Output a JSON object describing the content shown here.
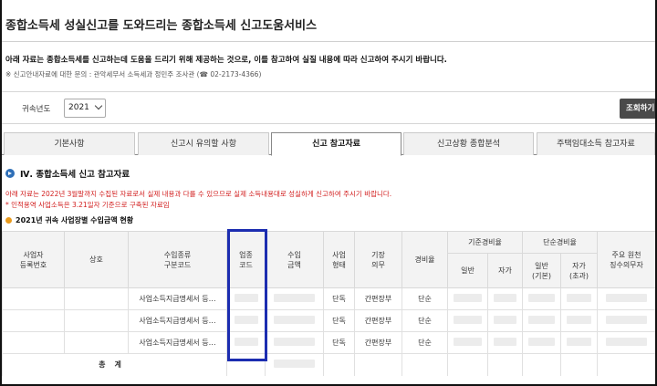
{
  "header": {
    "title": "종합소득세 성실신고를 도와드리는 종합소득세 신고도움서비스"
  },
  "notice": {
    "main": "아래 자료는 종합소득세를 신고하는데 도움을 드리기 위해 제공하는 것으로, 이를 참고하여 실질 내용에 따라 신고하여 주시기 바랍니다.",
    "sub": "※ 신고안내자료에 대한 문의 : 관악세무서 소득세과 정민주 조사관 (☎ 02-2173-4366)"
  },
  "filter": {
    "year_label": "귀속년도",
    "year_value": "2021",
    "search_button": "조회하기"
  },
  "tabs": [
    {
      "label": "기본사항"
    },
    {
      "label": "신고시 유의할 사항"
    },
    {
      "label": "신고 참고자료"
    },
    {
      "label": "신고상황 종합분석"
    },
    {
      "label": "주택임대소득 참고자료"
    }
  ],
  "section": {
    "title": "Ⅳ. 종합소득세 신고 참고자료",
    "red_note_1": "아래 자료는 2022년 3월말까지 수집된 자료로서 실제 내용과 다를 수 있으므로 실제 소득내용대로 성실하게 신고하여 주시기 바랍니다.",
    "red_note_2": "* 인적용역 사업소득은 3.21일자 기준으로 구축된 자료임",
    "subsection_title": "2021년 귀속 사업장별 수입금액 현황"
  },
  "table": {
    "headers": {
      "biz_no": "사업자\n등록번호",
      "name": "상호",
      "income_code": "수입종류\n구분코드",
      "industry_code": "업종\n코드",
      "revenue": "수입\n금액",
      "biz_type": "사업\n형태",
      "bookkeeping": "기장\n의무",
      "expense_rate": "경비율",
      "standard_rate": "기준경비율",
      "standard_general": "일반",
      "standard_self": "자가",
      "simple_rate": "단순경비율",
      "simple_general": "일반\n(기본)",
      "simple_self": "자가\n(초과)",
      "main_source": "주요 원천\n징수의무자"
    },
    "rows": [
      {
        "income_code": "사업소득지급명세서 등…",
        "biz_type": "단독",
        "bookkeeping": "간편장부",
        "expense_rate": "단순"
      },
      {
        "income_code": "사업소득지급명세서 등…",
        "biz_type": "단독",
        "bookkeeping": "간편장부",
        "expense_rate": "단순"
      },
      {
        "income_code": "사업소득지급명세서 등…",
        "biz_type": "단독",
        "bookkeeping": "간편장부",
        "expense_rate": "단순"
      }
    ],
    "total_label": "총계"
  }
}
